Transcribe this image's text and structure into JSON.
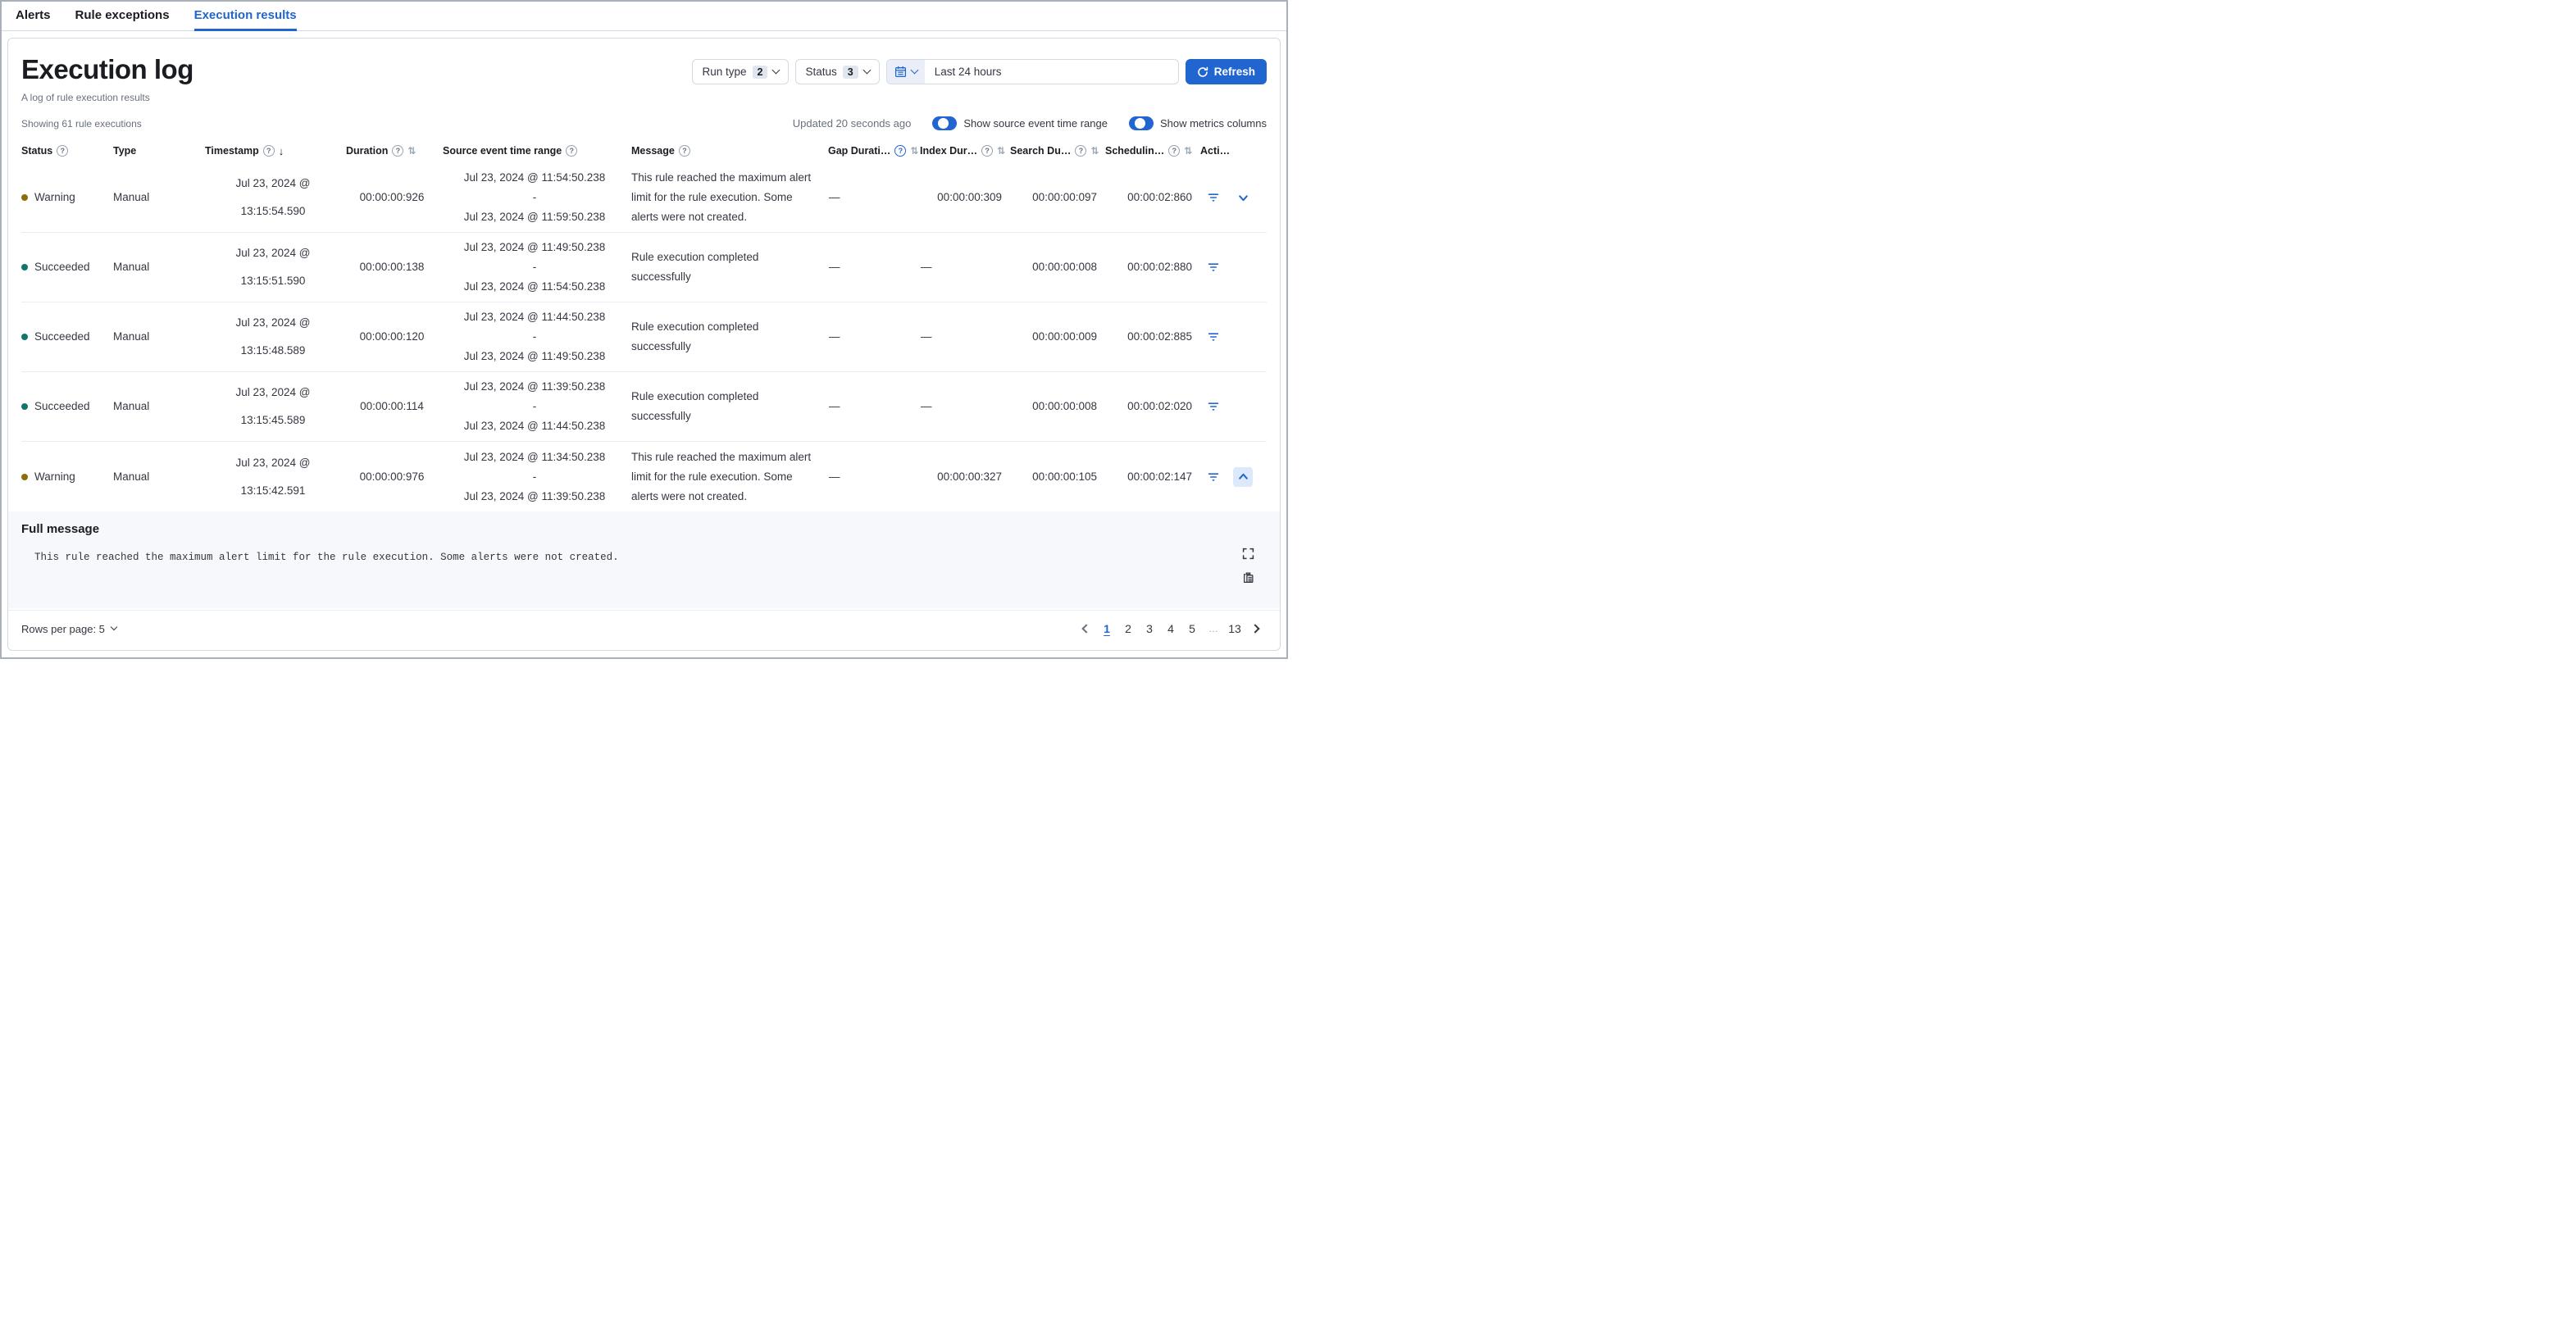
{
  "colors": {
    "accent": "#2065d0",
    "warning_dot": "#8d6d0b",
    "succeeded_dot": "#11756b"
  },
  "tabs": [
    {
      "label": "Alerts",
      "active": false
    },
    {
      "label": "Rule exceptions",
      "active": false
    },
    {
      "label": "Execution results",
      "active": true
    }
  ],
  "header": {
    "title": "Execution log",
    "subtitle": "A log of rule execution results"
  },
  "filters": {
    "run_type_label": "Run type",
    "run_type_count": "2",
    "status_label": "Status",
    "status_count": "3",
    "date_range": "Last 24 hours",
    "refresh_label": "Refresh"
  },
  "table_meta": {
    "showing": "Showing 61 rule executions",
    "updated": "Updated 20 seconds ago",
    "toggles": [
      {
        "label": "Show source event time range",
        "on": true
      },
      {
        "label": "Show metrics columns",
        "on": true
      }
    ]
  },
  "columns": [
    {
      "label": "Status"
    },
    {
      "label": "Type"
    },
    {
      "label": "Timestamp"
    },
    {
      "label": "Duration"
    },
    {
      "label": "Source event time range"
    },
    {
      "label": "Message"
    },
    {
      "label": "Gap Durati…"
    },
    {
      "label": "Index Dur…"
    },
    {
      "label": "Search Du…"
    },
    {
      "label": "Schedulin…"
    },
    {
      "label": "Acti…"
    }
  ],
  "rows": [
    {
      "status": "Warning",
      "dot": "warning",
      "type": "Manual",
      "timestamp": [
        "Jul 23, 2024 @",
        "13:15:54.590"
      ],
      "duration": "00:00:00:926",
      "source": [
        "Jul 23, 2024 @ 11:54:50.238",
        "-",
        "Jul 23, 2024 @ 11:59:50.238"
      ],
      "message": "This rule reached the maximum alert limit for the rule execution. Some alerts were not created.",
      "gap_duration": "—",
      "index_duration": "00:00:00:309",
      "search_duration": "00:00:00:097",
      "scheduling_duration": "00:00:02:860",
      "expand": "down"
    },
    {
      "status": "Succeeded",
      "dot": "succeeded",
      "type": "Manual",
      "timestamp": [
        "Jul 23, 2024 @",
        "13:15:51.590"
      ],
      "duration": "00:00:00:138",
      "source": [
        "Jul 23, 2024 @ 11:49:50.238",
        "-",
        "Jul 23, 2024 @ 11:54:50.238"
      ],
      "message": "Rule execution completed successfully",
      "gap_duration": "—",
      "index_duration": "—",
      "search_duration": "00:00:00:008",
      "scheduling_duration": "00:00:02:880",
      "expand": "none"
    },
    {
      "status": "Succeeded",
      "dot": "succeeded",
      "type": "Manual",
      "timestamp": [
        "Jul 23, 2024 @",
        "13:15:48.589"
      ],
      "duration": "00:00:00:120",
      "source": [
        "Jul 23, 2024 @ 11:44:50.238",
        "-",
        "Jul 23, 2024 @ 11:49:50.238"
      ],
      "message": "Rule execution completed successfully",
      "gap_duration": "—",
      "index_duration": "—",
      "search_duration": "00:00:00:009",
      "scheduling_duration": "00:00:02:885",
      "expand": "none"
    },
    {
      "status": "Succeeded",
      "dot": "succeeded",
      "type": "Manual",
      "timestamp": [
        "Jul 23, 2024 @",
        "13:15:45.589"
      ],
      "duration": "00:00:00:114",
      "source": [
        "Jul 23, 2024 @ 11:39:50.238",
        "-",
        "Jul 23, 2024 @ 11:44:50.238"
      ],
      "message": "Rule execution completed successfully",
      "gap_duration": "—",
      "index_duration": "—",
      "search_duration": "00:00:00:008",
      "scheduling_duration": "00:00:02:020",
      "expand": "none"
    },
    {
      "status": "Warning",
      "dot": "warning",
      "type": "Manual",
      "timestamp": [
        "Jul 23, 2024 @",
        "13:15:42.591"
      ],
      "duration": "00:00:00:976",
      "source": [
        "Jul 23, 2024 @ 11:34:50.238",
        "-",
        "Jul 23, 2024 @ 11:39:50.238"
      ],
      "message": "This rule reached the maximum alert limit for the rule execution. Some alerts were not created.",
      "gap_duration": "—",
      "index_duration": "00:00:00:327",
      "search_duration": "00:00:00:105",
      "scheduling_duration": "00:00:02:147",
      "expand": "up-active"
    }
  ],
  "expanded_row": {
    "title": "Full message",
    "message": "This rule reached the maximum alert limit for the rule execution. Some alerts were not created."
  },
  "footer": {
    "rows_per_page_label": "Rows per page: 5",
    "pages": [
      "1",
      "2",
      "3",
      "4",
      "5",
      "…",
      "13"
    ],
    "active_page": "1"
  }
}
